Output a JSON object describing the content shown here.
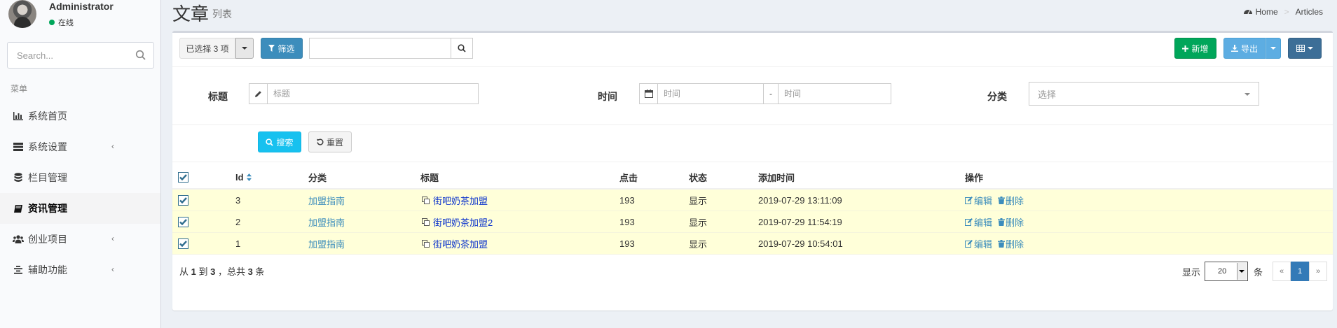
{
  "user": {
    "name": "Administrator",
    "status": "在线"
  },
  "sidebar": {
    "search_placeholder": "Search...",
    "menu_header": "菜单",
    "items": [
      {
        "label": "系统首页",
        "icon": "bar-chart-icon"
      },
      {
        "label": "系统设置",
        "icon": "server-icon",
        "has_children": true
      },
      {
        "label": "栏目管理",
        "icon": "database-icon"
      },
      {
        "label": "资讯管理",
        "icon": "book-icon",
        "active": true
      },
      {
        "label": "创业项目",
        "icon": "users-icon",
        "has_children": true
      },
      {
        "label": "辅助功能",
        "icon": "align-icon",
        "has_children": true
      }
    ]
  },
  "header": {
    "title": "文章",
    "subtitle": "列表",
    "breadcrumb": [
      "Home",
      "Articles"
    ]
  },
  "toolbar": {
    "selected_label": "已选择 3 项",
    "filter_label": "筛选",
    "search_value": "",
    "new_label": "新增",
    "export_label": "导出"
  },
  "filter_form": {
    "title_label": "标题",
    "title_placeholder": "标题",
    "time_label": "时间",
    "time_start_placeholder": "时间",
    "time_separator": "-",
    "time_end_placeholder": "时间",
    "category_label": "分类",
    "category_placeholder": "选择",
    "search_button": "搜索",
    "reset_button": "重置"
  },
  "table": {
    "columns": [
      "Id",
      "分类",
      "标题",
      "点击",
      "状态",
      "添加时间",
      "操作"
    ],
    "rows": [
      {
        "id": "3",
        "category": "加盟指南",
        "title": "街吧奶茶加盟",
        "clicks": "193",
        "status": "显示",
        "added": "2019-07-29 13:11:09",
        "edit": "编辑",
        "delete": "删除",
        "checked": true
      },
      {
        "id": "2",
        "category": "加盟指南",
        "title": "街吧奶茶加盟2",
        "clicks": "193",
        "status": "显示",
        "added": "2019-07-29 11:54:19",
        "edit": "编辑",
        "delete": "删除",
        "checked": true
      },
      {
        "id": "1",
        "category": "加盟指南",
        "title": "街吧奶茶加盟",
        "clicks": "193",
        "status": "显示",
        "added": "2019-07-29 10:54:01",
        "edit": "编辑",
        "delete": "删除",
        "checked": true
      }
    ]
  },
  "footer": {
    "summary_prefix": "从 ",
    "from": "1",
    "summary_mid1": " 到 ",
    "to": "3",
    "summary_mid2": " ，总共 ",
    "total": "3",
    "summary_suffix": " 条",
    "show_label": "显示",
    "page_size": "20",
    "unit_label": "条",
    "prev": "«",
    "current_page": "1",
    "next": "»"
  },
  "colors": {
    "primary": "#3c8dbc",
    "success": "#00a65a",
    "info": "#17c1ef",
    "selected_row": "#ffffd9",
    "status_online": "#00a65a"
  }
}
